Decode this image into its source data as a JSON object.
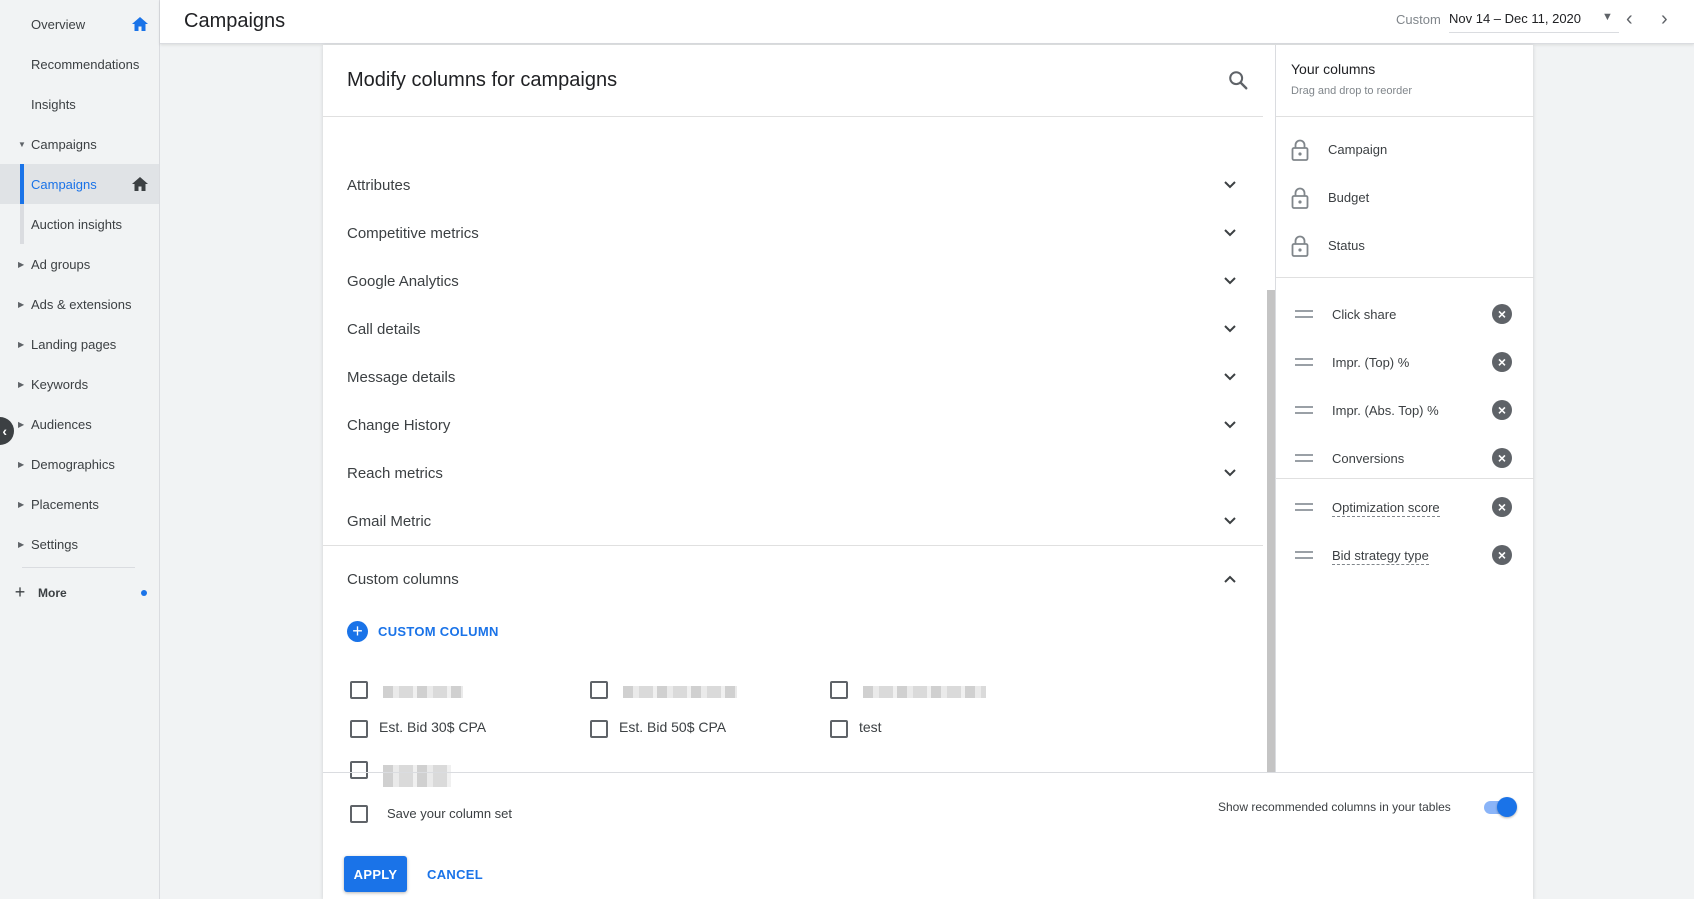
{
  "sidebar": {
    "items": [
      {
        "label": "Overview"
      },
      {
        "label": "Recommendations"
      },
      {
        "label": "Insights"
      },
      {
        "label": "Campaigns"
      },
      {
        "label": "Campaigns"
      },
      {
        "label": "Auction insights"
      },
      {
        "label": "Ad groups"
      },
      {
        "label": "Ads & extensions"
      },
      {
        "label": "Landing pages"
      },
      {
        "label": "Keywords"
      },
      {
        "label": "Audiences"
      },
      {
        "label": "Demographics"
      },
      {
        "label": "Placements"
      },
      {
        "label": "Settings"
      }
    ],
    "more_label": "More"
  },
  "header": {
    "title": "Campaigns",
    "date_label": "Custom",
    "date_range": "Nov 14 – Dec 11, 2020"
  },
  "dialog": {
    "title": "Modify columns for campaigns",
    "categories": [
      {
        "label": "Attributes"
      },
      {
        "label": "Competitive metrics"
      },
      {
        "label": "Google Analytics"
      },
      {
        "label": "Call details"
      },
      {
        "label": "Message details"
      },
      {
        "label": "Change History"
      },
      {
        "label": "Reach metrics"
      },
      {
        "label": "Gmail Metric"
      }
    ],
    "custom_section": {
      "label": "Custom columns",
      "add_label": "CUSTOM COLUMN",
      "options": [
        {
          "label": "Est. Bid 30$ CPA"
        },
        {
          "label": "Est. Bid 50$ CPA"
        },
        {
          "label": "test"
        }
      ]
    }
  },
  "your_columns": {
    "title": "Your columns",
    "subtitle": "Drag and drop to reorder",
    "locked": [
      {
        "label": "Campaign"
      },
      {
        "label": "Budget"
      },
      {
        "label": "Status"
      }
    ],
    "selected": [
      {
        "label": "Click share"
      },
      {
        "label": "Impr. (Top) %"
      },
      {
        "label": "Impr. (Abs. Top) %"
      },
      {
        "label": "Conversions"
      },
      {
        "label": "Optimization score"
      },
      {
        "label": "Bid strategy type"
      }
    ]
  },
  "footer": {
    "save_label": "Save your column set",
    "recommended_label": "Show recommended columns in your tables",
    "recommended_on": true,
    "apply_label": "APPLY",
    "cancel_label": "CANCEL"
  },
  "colors": {
    "accent": "#1a73e8",
    "sidebar_bg": "#f1f3f4"
  }
}
